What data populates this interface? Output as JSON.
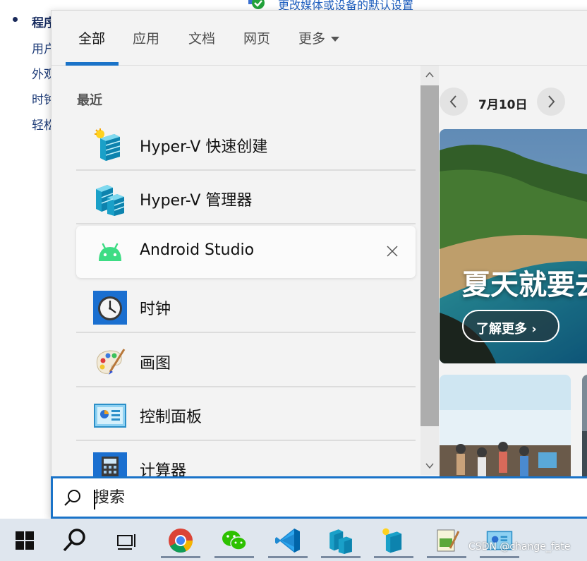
{
  "background": {
    "top_link": "更改媒体或设备的默认设置",
    "items": [
      {
        "label": "程序",
        "bold": true
      },
      {
        "label": "用户",
        "bold": false
      },
      {
        "label": "外观",
        "bold": false
      },
      {
        "label": "时钟",
        "bold": false
      },
      {
        "label": "轻松",
        "bold": false
      }
    ]
  },
  "search": {
    "tabs": [
      {
        "label": "全部",
        "active": true
      },
      {
        "label": "应用",
        "active": false
      },
      {
        "label": "文档",
        "active": false
      },
      {
        "label": "网页",
        "active": false
      },
      {
        "label": "更多",
        "active": false,
        "dropdown": true
      }
    ],
    "section_label": "最近",
    "recent": [
      {
        "label": "Hyper-V 快速创建",
        "icon": "hyperv-quick-create-icon",
        "selected": false
      },
      {
        "label": "Hyper-V 管理器",
        "icon": "hyperv-manager-icon",
        "selected": false
      },
      {
        "label": "Android Studio",
        "icon": "android-icon",
        "selected": true
      },
      {
        "label": "时钟",
        "icon": "clock-icon",
        "selected": false
      },
      {
        "label": "画图",
        "icon": "paint-icon",
        "selected": false
      },
      {
        "label": "控制面板",
        "icon": "control-panel-icon",
        "selected": false
      },
      {
        "label": "计算器",
        "icon": "calculator-icon",
        "selected": false
      }
    ],
    "date_label": "7月10日",
    "hero_title": "夏天就要去",
    "hero_button": "了解更多 ›",
    "placeholder": "搜索",
    "accent_color": "#1a73c8"
  },
  "taskbar": {
    "items": [
      {
        "icon": "windows-start-icon",
        "open": false
      },
      {
        "icon": "search-icon",
        "open": false
      },
      {
        "icon": "task-view-icon",
        "open": false
      },
      {
        "icon": "chrome-icon",
        "open": true
      },
      {
        "icon": "wechat-icon",
        "open": true
      },
      {
        "icon": "vscode-icon",
        "open": true
      },
      {
        "icon": "hyperv-manager-icon",
        "open": true
      },
      {
        "icon": "hyperv-quick-create-icon",
        "open": true
      },
      {
        "icon": "notepad-icon",
        "open": true
      },
      {
        "icon": "control-panel-icon",
        "open": true
      }
    ],
    "watermark": "CSDN @change_fate"
  }
}
